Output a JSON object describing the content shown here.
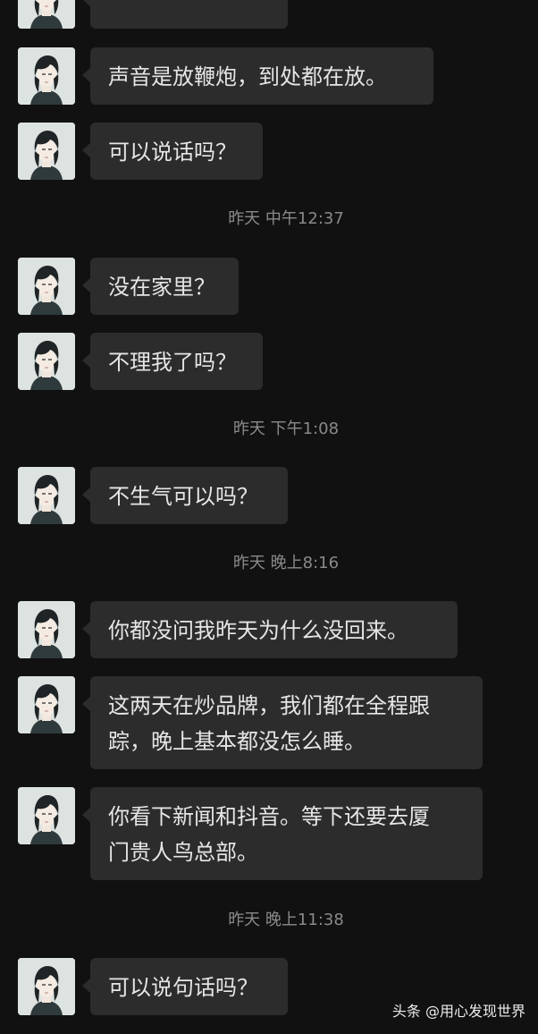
{
  "messages": [
    {
      "type": "msg",
      "text": ""
    },
    {
      "type": "msg",
      "text": "声音是放鞭炮，到处都在放。"
    },
    {
      "type": "msg",
      "text": "可以说话吗？"
    },
    {
      "type": "time",
      "text": "昨天 中午12:37"
    },
    {
      "type": "msg",
      "text": "没在家里？"
    },
    {
      "type": "msg",
      "text": "不理我了吗？"
    },
    {
      "type": "time",
      "text": "昨天 下午1:08"
    },
    {
      "type": "msg",
      "text": "不生气可以吗？"
    },
    {
      "type": "time",
      "text": "昨天 晚上8:16"
    },
    {
      "type": "msg",
      "text": "你都没问我昨天为什么没回来。"
    },
    {
      "type": "msg",
      "text": "这两天在炒品牌，我们都在全程跟\n踪，晚上基本都没怎么睡。"
    },
    {
      "type": "msg",
      "text": "你看下新闻和抖音。等下还要去厦\n门贵人鸟总部。"
    },
    {
      "type": "time",
      "text": "昨天 晚上11:38"
    },
    {
      "type": "msg",
      "text": "可以说句话吗？"
    }
  ],
  "watermark": "头条 @用心发现世界",
  "avatar_icon": "contact-avatar-anime-portrait"
}
